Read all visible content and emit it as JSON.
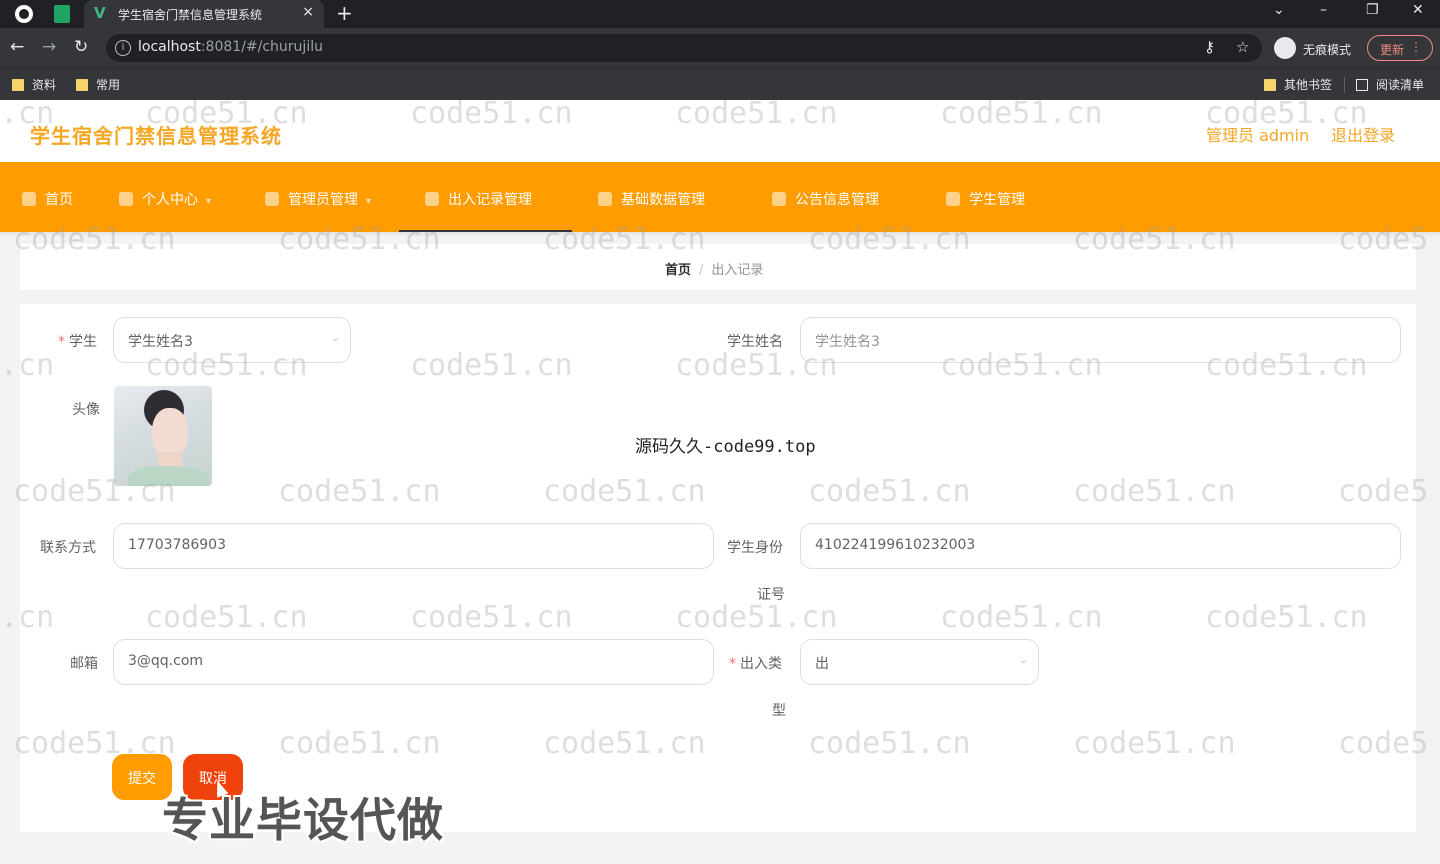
{
  "browser": {
    "tab_title": "学生宿舍门禁信息管理系统",
    "tab_close": "×",
    "new_tab": "+",
    "window_controls": [
      "⌄",
      "–",
      "❐",
      "✕"
    ],
    "nav": {
      "back": "←",
      "forward": "→",
      "reload": "↻"
    },
    "url_host": "localhost",
    "url_path": ":8081/#/churujilu",
    "info_icon": "i",
    "key_icon": "⚷",
    "star_icon": "☆",
    "incognito_label": "无痕模式",
    "update_label": "更新",
    "menu_dots": "⋮",
    "bookmarks": [
      "资料",
      "常用"
    ],
    "bookmarks_right": [
      "其他书签",
      "阅读清单"
    ]
  },
  "header": {
    "title": "学生宿舍门禁信息管理系统",
    "admin_label": "管理员 admin",
    "logout_label": "退出登录"
  },
  "menu": {
    "items": [
      {
        "label": "首页",
        "icon": "home-icon"
      },
      {
        "label": "个人中心",
        "icon": "user-icon"
      },
      {
        "label": "管理员管理",
        "icon": "admin-icon"
      },
      {
        "label": "出入记录管理",
        "icon": "record-icon"
      },
      {
        "label": "基础数据管理",
        "icon": "data-icon"
      },
      {
        "label": "公告信息管理",
        "icon": "notice-icon"
      },
      {
        "label": "学生管理",
        "icon": "student-icon"
      }
    ],
    "active_index": 3,
    "accent_color": "#ff9c00"
  },
  "breadcrumb": {
    "home": "首页",
    "separator": "/",
    "current": "出入记录"
  },
  "form": {
    "student_label": "学生",
    "student_value": "学生姓名3",
    "student_name_label": "学生姓名",
    "student_name_value": "学生姓名3",
    "avatar_label": "头像",
    "phone_label": "联系方式",
    "phone_value": "17703786903",
    "idcard_label_line1": "学生身份",
    "idcard_label_line2": "证号",
    "idcard_value": "410224199610232003",
    "email_label": "邮箱",
    "email_value": "3@qq.com",
    "type_label_line1": "出入类",
    "type_label_line2": "型",
    "type_value": "出",
    "required_mark": "*",
    "chevron": "⌄",
    "submit_label": "提交",
    "cancel_label": "取消"
  },
  "overlays": {
    "watermark": "code51.cn",
    "watermark_partial_left": ".cn",
    "watermark_partial_right": "code5",
    "center_text": "源码久久-code99.top",
    "big_text": "专业毕设代做"
  }
}
